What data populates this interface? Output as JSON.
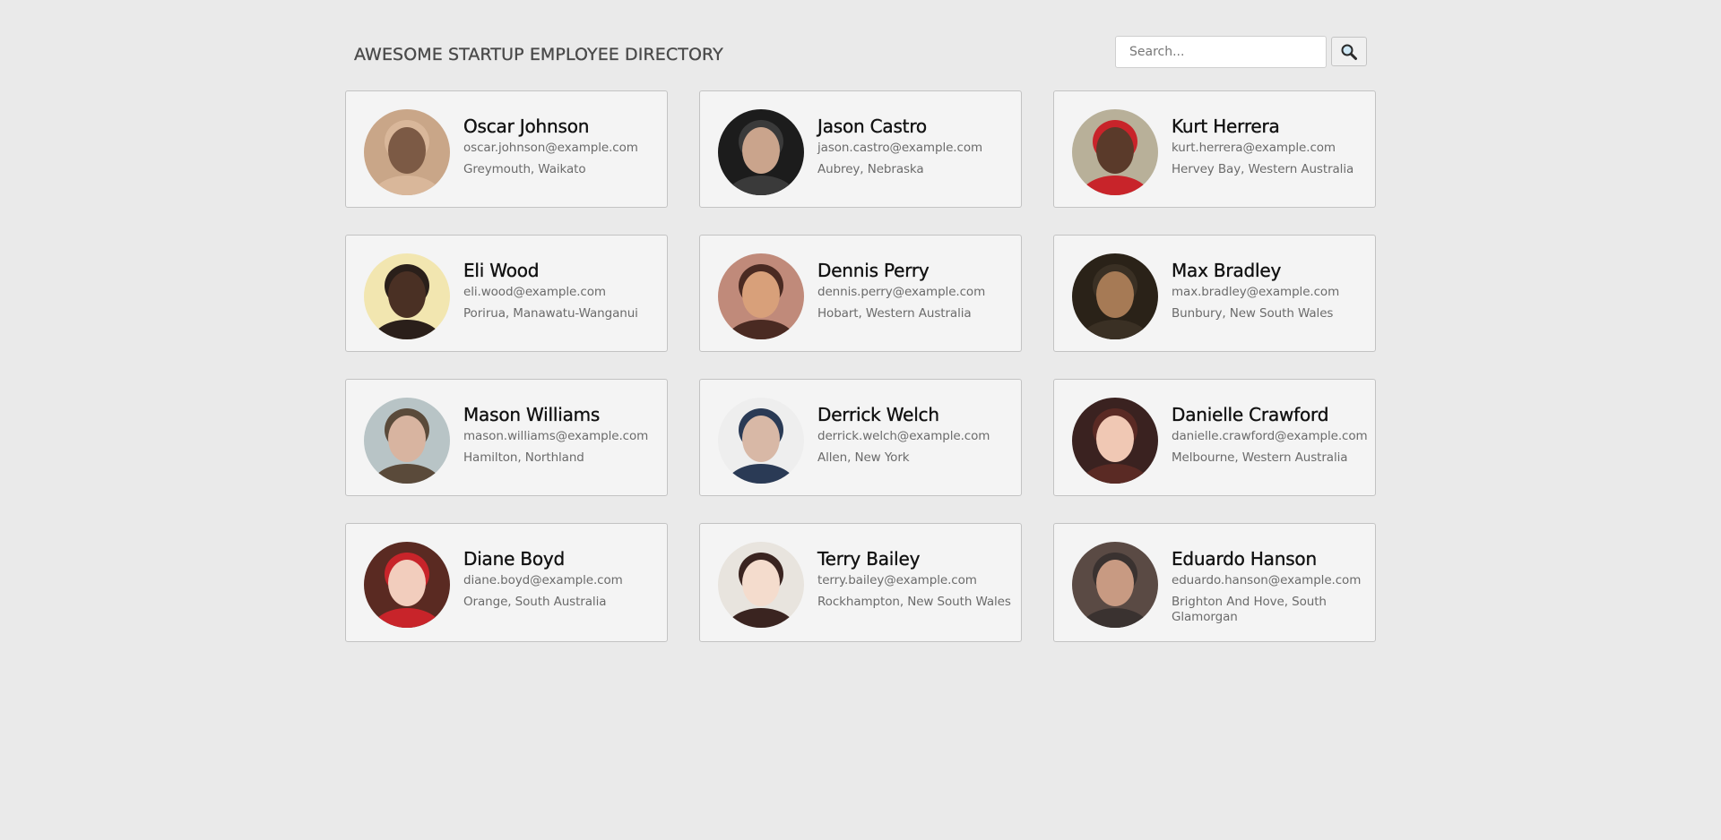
{
  "header": {
    "title": "AWESOME STARTUP EMPLOYEE DIRECTORY",
    "search_placeholder": "Search...",
    "search_icon": "magnifier-icon"
  },
  "employees": [
    {
      "name": "Oscar Johnson",
      "email": "oscar.johnson@example.com",
      "location": "Greymouth, Waikato",
      "avatar_colors": [
        "#c9a688",
        "#7c5a45",
        "#d9b79a"
      ]
    },
    {
      "name": "Jason Castro",
      "email": "jason.castro@example.com",
      "location": "Aubrey, Nebraska",
      "avatar_colors": [
        "#1c1c1c",
        "#caa48c",
        "#3a3a3a"
      ]
    },
    {
      "name": "Kurt Herrera",
      "email": "kurt.herrera@example.com",
      "location": "Hervey Bay, Western Australia",
      "avatar_colors": [
        "#b8b099",
        "#5a3a2a",
        "#c8242a"
      ]
    },
    {
      "name": "Eli Wood",
      "email": "eli.wood@example.com",
      "location": "Porirua, Manawatu-Wanganui",
      "avatar_colors": [
        "#f2e6b0",
        "#4a3024",
        "#2a1f1a"
      ]
    },
    {
      "name": "Dennis Perry",
      "email": "dennis.perry@example.com",
      "location": "Hobart, Western Australia",
      "avatar_colors": [
        "#c08a7a",
        "#d8a07a",
        "#4a2a22"
      ]
    },
    {
      "name": "Max Bradley",
      "email": "max.bradley@example.com",
      "location": "Bunbury, New South Wales",
      "avatar_colors": [
        "#2a2218",
        "#a67a55",
        "#3a3024"
      ]
    },
    {
      "name": "Mason Williams",
      "email": "mason.williams@example.com",
      "location": "Hamilton, Northland",
      "avatar_colors": [
        "#b8c4c6",
        "#d8b4a0",
        "#5a4a3a"
      ]
    },
    {
      "name": "Derrick Welch",
      "email": "derrick.welch@example.com",
      "location": "Allen, New York",
      "avatar_colors": [
        "#eeeeee",
        "#d8b8a6",
        "#2a3a55"
      ]
    },
    {
      "name": "Danielle Crawford",
      "email": "danielle.crawford@example.com",
      "location": "Melbourne, Western Australia",
      "avatar_colors": [
        "#3a2220",
        "#f0c8b4",
        "#5a2a24"
      ]
    },
    {
      "name": "Diane Boyd",
      "email": "diane.boyd@example.com",
      "location": "Orange, South Australia",
      "avatar_colors": [
        "#5a2a22",
        "#f2cdbd",
        "#c8242a"
      ]
    },
    {
      "name": "Terry Bailey",
      "email": "terry.bailey@example.com",
      "location": "Rockhampton, New South Wales",
      "avatar_colors": [
        "#e8e4de",
        "#f4dccd",
        "#3a2420"
      ]
    },
    {
      "name": "Eduardo Hanson",
      "email": "eduardo.hanson@example.com",
      "location": "Brighton And Hove, South Glamorgan",
      "avatar_colors": [
        "#5a4a44",
        "#c89a82",
        "#3a3230"
      ]
    }
  ]
}
